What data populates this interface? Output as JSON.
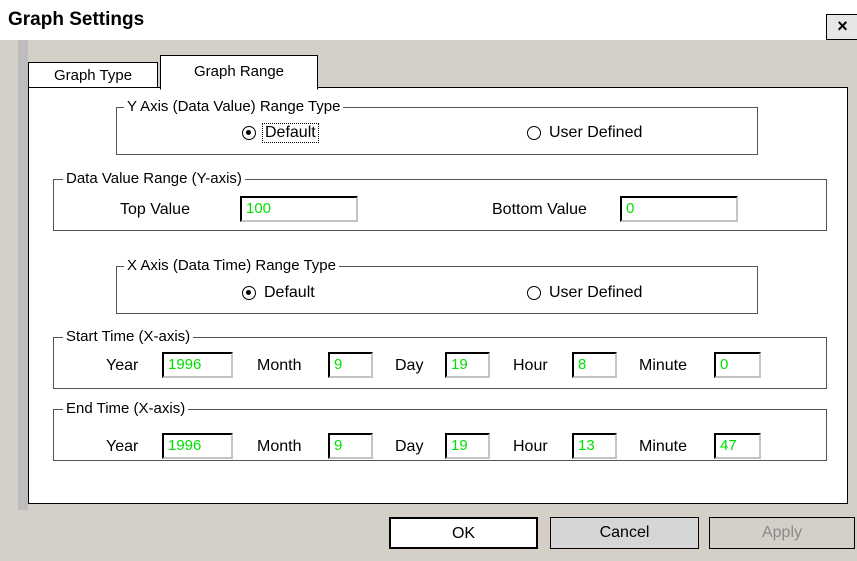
{
  "window": {
    "title": "Graph Settings",
    "close_glyph": "×"
  },
  "tabs": [
    {
      "label": "Graph Type",
      "active": false
    },
    {
      "label": "Graph Range",
      "active": true
    }
  ],
  "y_axis_range_type": {
    "legend": "Y Axis (Data Value) Range Type",
    "options": [
      {
        "label": "Default",
        "checked": true
      },
      {
        "label": "User Defined",
        "checked": false
      }
    ]
  },
  "data_value_range": {
    "legend": "Data Value Range (Y-axis)",
    "top_label": "Top Value",
    "top_value": "100",
    "bottom_label": "Bottom Value",
    "bottom_value": "0"
  },
  "x_axis_range_type": {
    "legend": "X Axis (Data Time) Range Type",
    "options": [
      {
        "label": "Default",
        "checked": true
      },
      {
        "label": "User Defined",
        "checked": false
      }
    ]
  },
  "start_time": {
    "legend": "Start Time (X-axis)",
    "year_label": "Year",
    "year": "1996",
    "month_label": "Month",
    "month": "9",
    "day_label": "Day",
    "day": "19",
    "hour_label": "Hour",
    "hour": "8",
    "minute_label": "Minute",
    "minute": "0"
  },
  "end_time": {
    "legend": "End Time (X-axis)",
    "year_label": "Year",
    "year": "1996",
    "month_label": "Month",
    "month": "9",
    "day_label": "Day",
    "day": "19",
    "hour_label": "Hour",
    "hour": "13",
    "minute_label": "Minute",
    "minute": "47"
  },
  "buttons": {
    "ok": "OK",
    "cancel": "Cancel",
    "apply": "Apply"
  },
  "colors": {
    "field_text": "#00e000",
    "dialog_bg": "#d4d0c8"
  }
}
